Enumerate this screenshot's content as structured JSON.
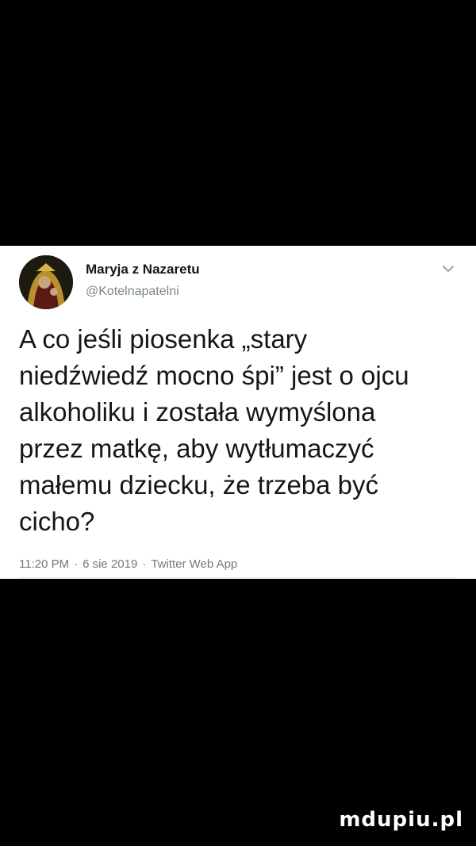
{
  "tweet": {
    "display_name": "Maryja z Nazaretu",
    "handle": "@Kotelnapatelni",
    "text": "A co jeśli piosenka „stary\nniedźwiedź mocno śpi” jest o ojcu\nalkoholiku i została wymyślona\nprzez matkę, aby wytłumaczyć\nmałemu dziecku, że trzeba być\ncicho?",
    "time": "11:20 PM",
    "date": "6 sie 2019",
    "source": "Twitter Web App",
    "separator": "·"
  },
  "icons": {
    "avatar": "avatar-icon",
    "menu": "chevron-down-icon"
  },
  "watermark": {
    "text": "mdupiu.pl"
  },
  "colors": {
    "background": "#000000",
    "card": "#ffffff",
    "text": "#14171a",
    "secondary": "#7b8790"
  }
}
